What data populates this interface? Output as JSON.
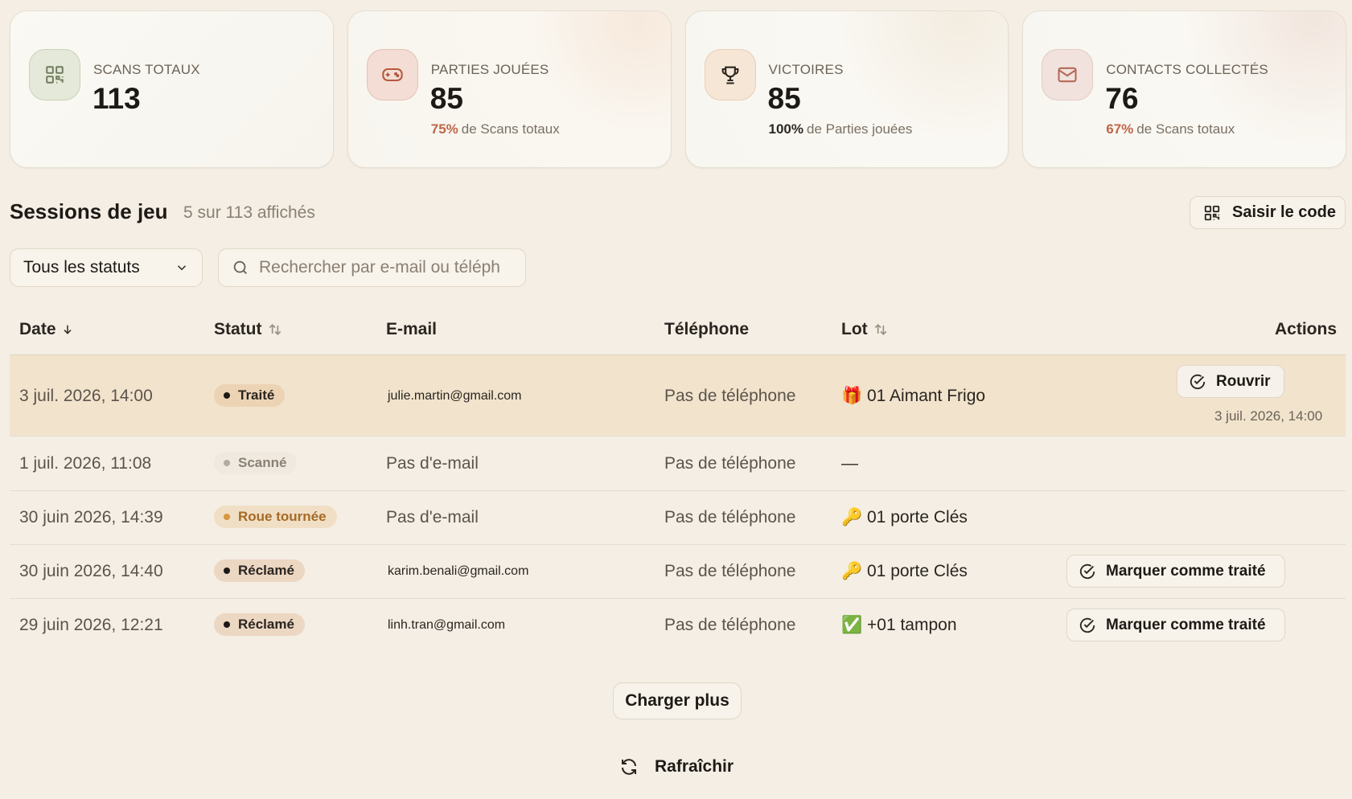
{
  "stats": [
    {
      "label": "SCANS TOTAUX",
      "value": "113",
      "pct": "",
      "sub": "",
      "icon": "qr-code-icon"
    },
    {
      "label": "PARTIES JOUÉES",
      "value": "85",
      "pct": "75%",
      "sub": "de Scans totaux",
      "icon": "gamepad-icon"
    },
    {
      "label": "VICTOIRES",
      "value": "85",
      "pct": "100%",
      "sub": "de Parties jouées",
      "icon": "trophy-icon"
    },
    {
      "label": "CONTACTS COLLECTÉS",
      "value": "76",
      "pct": "67%",
      "sub": "de Scans totaux",
      "icon": "mail-icon"
    }
  ],
  "sessions": {
    "title": "Sessions de jeu",
    "count": "5 sur 113 affichés",
    "enter_code_label": "Saisir le code"
  },
  "filters": {
    "status_value": "Tous les statuts",
    "search_placeholder": "Rechercher par e-mail ou téléphone"
  },
  "table": {
    "headers": {
      "date": "Date",
      "status": "Statut",
      "email": "E-mail",
      "phone": "Téléphone",
      "lot": "Lot",
      "actions": "Actions"
    },
    "rows": [
      {
        "date": "3 juil. 2026, 14:00",
        "status": "Traité",
        "email": "julie.martin@gmail.com",
        "phone": "Pas de téléphone",
        "lot_emoji": "🎁",
        "lot": "01 Aimant Frigo",
        "action": "Rouvrir",
        "action_note": "3 juil. 2026, 14:00"
      },
      {
        "date": "1 juil. 2026, 11:08",
        "status": "Scanné",
        "email": "Pas d'e-mail",
        "phone": "Pas de téléphone",
        "lot_emoji": "",
        "lot": "—",
        "action": "",
        "action_note": ""
      },
      {
        "date": "30 juin 2026, 14:39",
        "status": "Roue tournée",
        "email": "Pas d'e-mail",
        "phone": "Pas de téléphone",
        "lot_emoji": "🔑",
        "lot": "01 porte Clés",
        "action": "",
        "action_note": ""
      },
      {
        "date": "30 juin 2026, 14:40",
        "status": "Réclamé",
        "email": "karim.benali@gmail.com",
        "phone": "Pas de téléphone",
        "lot_emoji": "🔑",
        "lot": "01 porte Clés",
        "action": "Marquer comme traité",
        "action_note": ""
      },
      {
        "date": "29 juin 2026, 12:21",
        "status": "Réclamé",
        "email": "linh.tran@gmail.com",
        "phone": "Pas de téléphone",
        "lot_emoji": "✅",
        "lot": "+01 tampon",
        "action": "Marquer comme traité",
        "action_note": ""
      }
    ]
  },
  "footer": {
    "load_more": "Charger plus",
    "refresh": "Rafraîchir"
  },
  "colors": {
    "background": "#f4eee4",
    "highlight_row": "#f1e3cc",
    "accent_red": "#c0664a",
    "status_orange": "#d89640"
  }
}
